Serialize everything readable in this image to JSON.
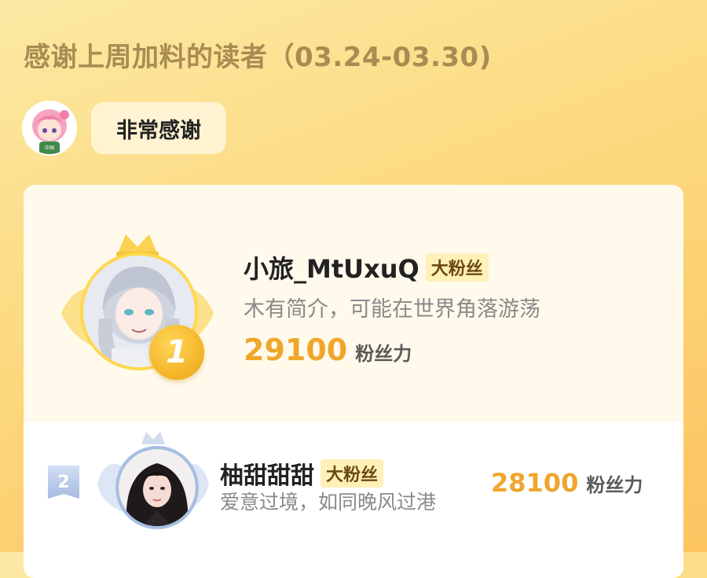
{
  "header": {
    "title": "感谢上周加料的读者（03.24-03.30)"
  },
  "message": {
    "text": "非常感谢"
  },
  "leaderboard": [
    {
      "rank": "1",
      "name": "小旅_MtUxuQ",
      "badge": "大粉丝",
      "bio": "木有简介，可能在世界角落游荡",
      "points": "29100",
      "points_unit": "粉丝力",
      "accent_color": "#ffd84d"
    },
    {
      "rank": "2",
      "name": "柚甜甜甜",
      "badge": "大粉丝",
      "bio": "爱意过境，如同晚风过港",
      "points": "28100",
      "points_unit": "粉丝力",
      "accent_color": "#a8bfe4"
    }
  ],
  "colors": {
    "background": "#fcd97e",
    "title": "#a98c52",
    "points": "#f0a62c",
    "badge_bg": "#fff0b8"
  }
}
